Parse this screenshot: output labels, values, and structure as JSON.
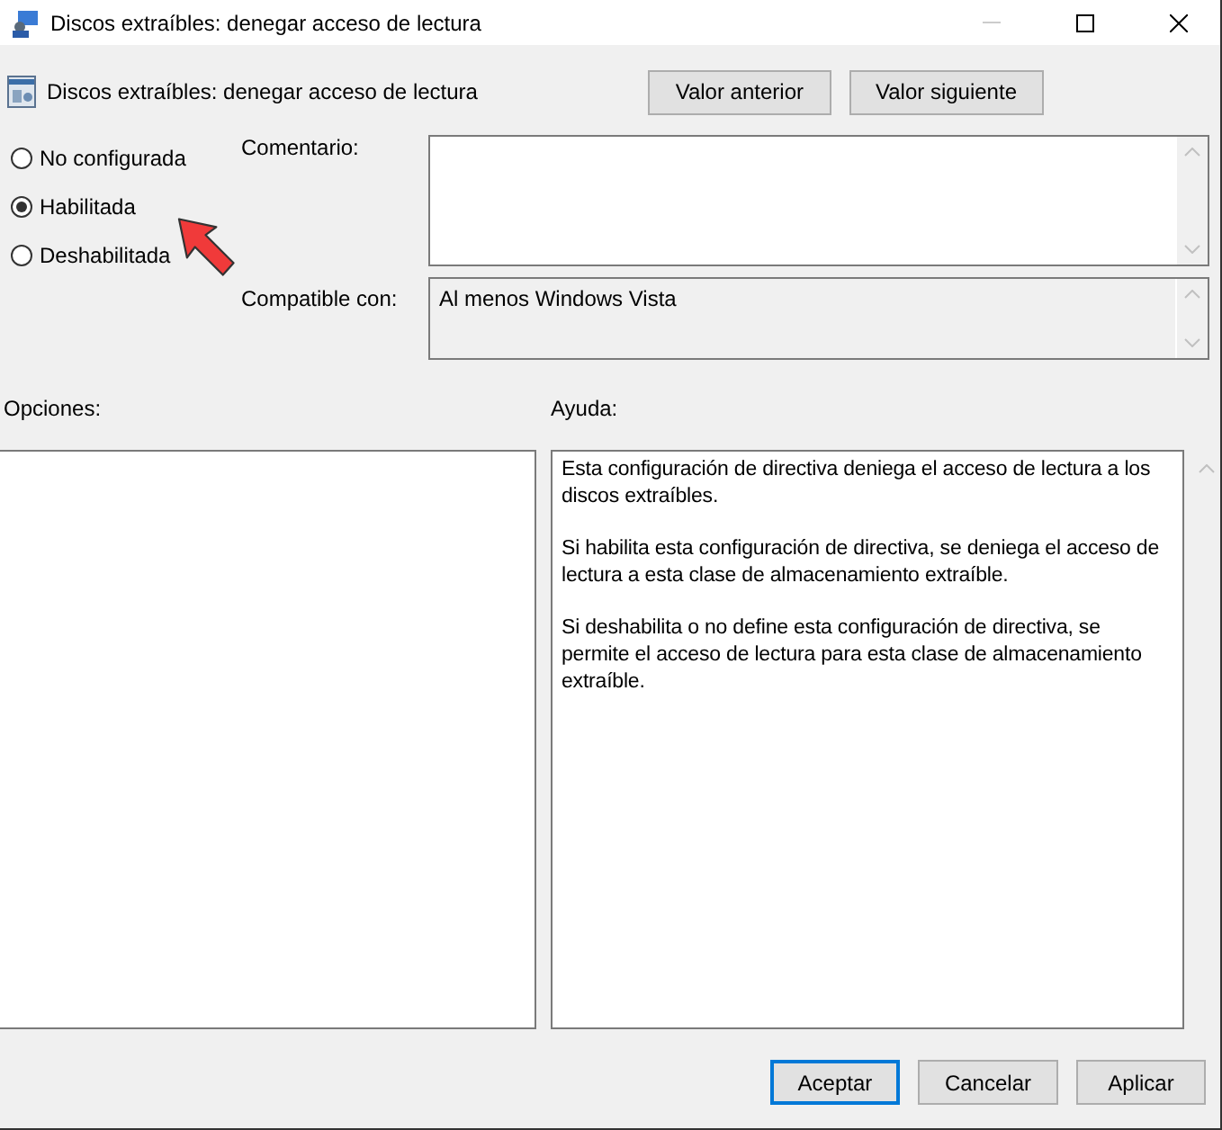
{
  "window": {
    "title": "Discos extraíbles: denegar acceso de lectura"
  },
  "policy_title": "Discos extraíbles: denegar acceso de lectura",
  "nav_buttons": [
    "Valor anterior",
    "Valor siguiente"
  ],
  "state_options": [
    {
      "label": "No configurada",
      "selected": false
    },
    {
      "label": "Habilitada",
      "selected": true
    },
    {
      "label": "Deshabilitada",
      "selected": false
    }
  ],
  "comment": {
    "label": "Comentario:"
  },
  "compatible": {
    "label": "Compatible con:",
    "value": "Al menos Windows Vista"
  },
  "options": {
    "label": "Opciones:"
  },
  "help": {
    "label": "Ayuda:",
    "paragraphs": [
      "Esta configuración de directiva deniega el acceso de lectura a los discos extraíbles.",
      "Si habilita esta configuración de directiva, se deniega el acceso de lectura a esta clase de almacenamiento extraíble.",
      "Si deshabilita o no define esta configuración de directiva, se permite el acceso de lectura para esta clase de almacenamiento extraíble."
    ]
  },
  "buttons": [
    {
      "label": "Aceptar",
      "default": true
    },
    {
      "label": "Cancelar",
      "default": false
    },
    {
      "label": "Aplicar",
      "default": false
    }
  ]
}
